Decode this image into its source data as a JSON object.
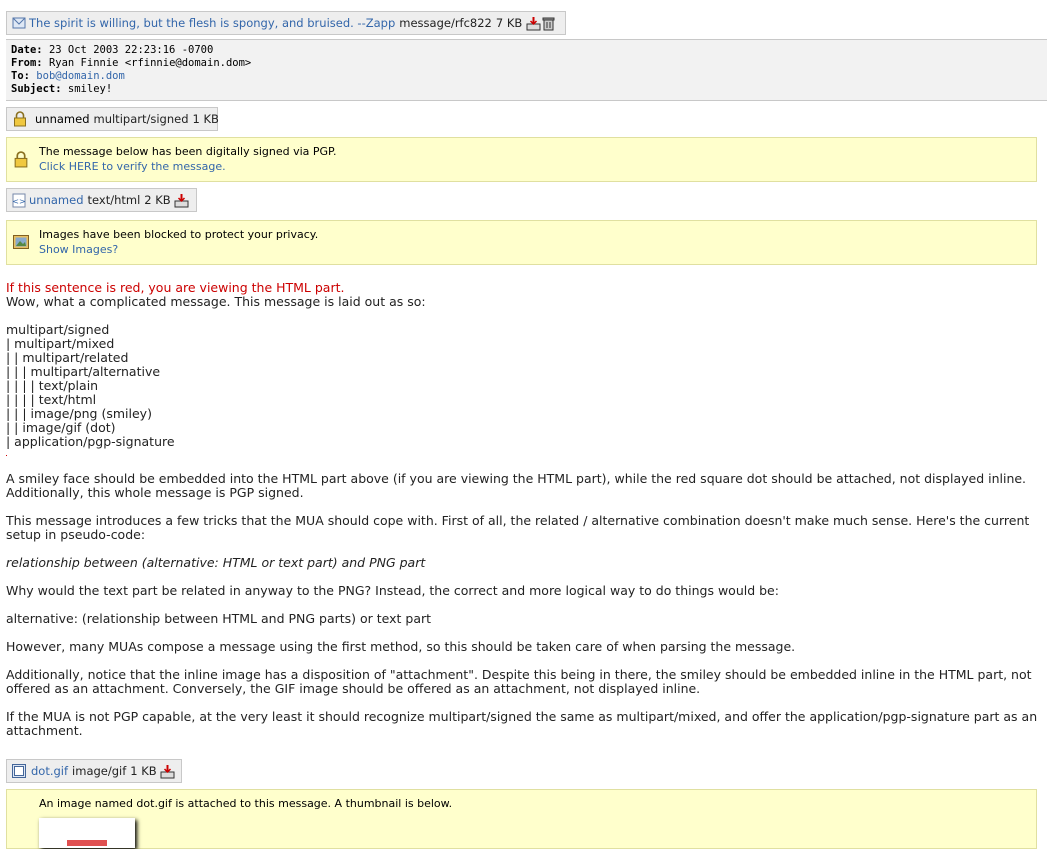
{
  "top_part": {
    "subject_link": "The spirit is willing, but the flesh is spongy, and bruised. --Zapp",
    "type": "message/rfc822",
    "size": "7 KB"
  },
  "headers": {
    "date_label": "Date:",
    "date_value": "23 Oct 2003 22:23:16 -0700",
    "from_label": "From:",
    "from_name": "Ryan Finnie",
    "from_email": "<rfinnie@domain.dom>",
    "to_label": "To:",
    "to_value": "bob@domain.dom",
    "subject_label": "Subject:",
    "subject_value": "smiley!"
  },
  "signed_part": {
    "name": "unnamed",
    "type": "multipart/signed",
    "size": "1 KB"
  },
  "pgp_notice": {
    "text": "The message below has been digitally signed via PGP.",
    "link": "Click HERE to verify the message."
  },
  "html_part": {
    "name": "unnamed",
    "type": "text/html",
    "size": "2 KB"
  },
  "images_notice": {
    "text": "Images have been blocked to protect your privacy.",
    "link": "Show Images?"
  },
  "message": {
    "red_line": "If this sentence is red, you are viewing the HTML part.",
    "intro": "Wow, what a complicated message.  This message is laid out as so:",
    "tree": [
      "multipart/signed",
      "| multipart/mixed",
      "| | multipart/related",
      "| | | multipart/alternative",
      "| | | | text/plain",
      "| | | | text/html",
      "| | | image/png (smiley)",
      "| | image/gif (dot)",
      "| application/pgp-signature"
    ],
    "para1": "A smiley face should be embedded into the HTML part above (if you are viewing the HTML part), while the red square dot should be attached, not displayed inline.  Additionally, this whole message is PGP signed.",
    "para2": "This message introduces a few tricks that the MUA should cope with.  First of all, the related / alternative combination doesn't make much sense.  Here's the current setup in pseudo-code:",
    "para3": "relationship between (alternative: HTML or text part) and PNG part",
    "para4": "Why would the text part be related in anyway to the PNG?  Instead, the correct and more logical way to do things would be:",
    "para5": "alternative: (relationship between HTML and PNG parts) or text part",
    "para6": "However, many MUAs compose a message using the first method, so this should be taken care of when parsing the message.",
    "para7": "Additionally, notice that the inline image has a disposition of \"attachment\".  Despite this being in there, the smiley should be embedded inline in the HTML part, not offered as an attachment.  Conversely, the GIF image should be offered as an attachment, not displayed inline.",
    "para8": "If the MUA is not PGP capable, at the very least it should recognize multipart/signed the same as multipart/mixed, and offer the application/pgp-signature part as an attachment."
  },
  "gif_part": {
    "name": "dot.gif",
    "type": "image/gif",
    "size": "1 KB"
  },
  "gif_notice": {
    "text": "An image named dot.gif is attached to this message. A thumbnail is below."
  },
  "colors": {
    "link": "#3366aa",
    "notice_bg": "#ffffcc",
    "red_text": "#cc0000"
  }
}
